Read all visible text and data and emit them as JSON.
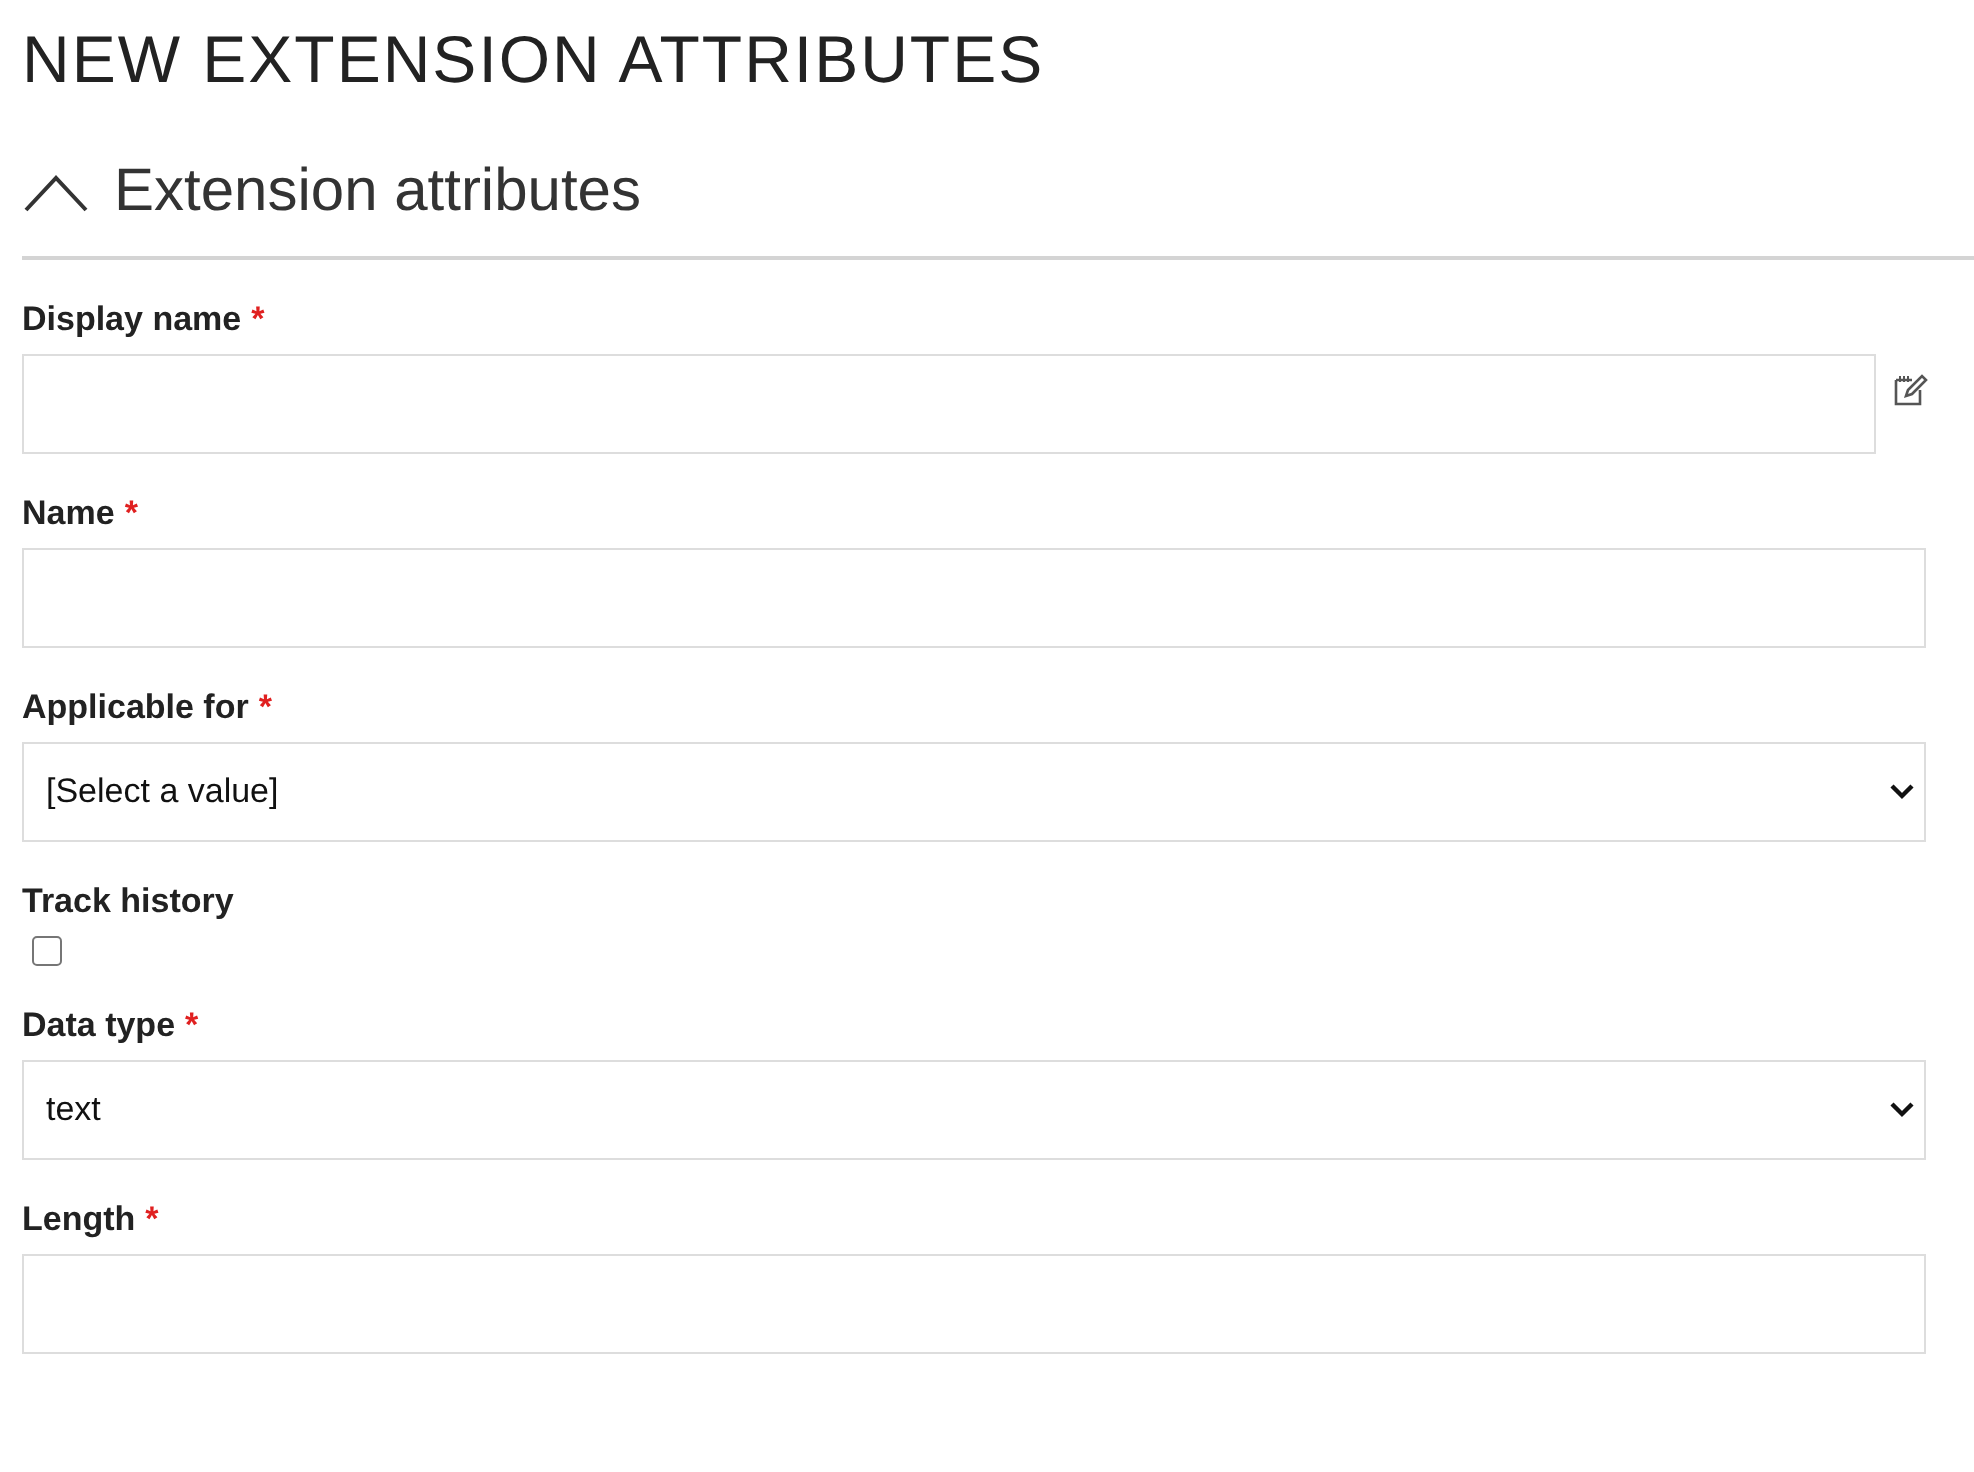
{
  "page_title": "NEW EXTENSION ATTRIBUTES",
  "section": {
    "title": "Extension attributes",
    "expanded": true
  },
  "fields": [
    {
      "kind": "text",
      "label": "Display name",
      "marker": "*",
      "edit_icon": true
    },
    {
      "kind": "text",
      "label": "Name",
      "marker": "*",
      "edit_icon": false
    },
    {
      "kind": "select",
      "label": "Applicable for",
      "marker": "*",
      "value": "[Select a value]"
    },
    {
      "kind": "checkbox",
      "label": "Track history",
      "checked": false
    },
    {
      "kind": "select",
      "label": "Data type",
      "marker": "*",
      "value": "text"
    },
    {
      "kind": "text",
      "label": "Length",
      "marker": "*",
      "edit_icon": false
    }
  ]
}
